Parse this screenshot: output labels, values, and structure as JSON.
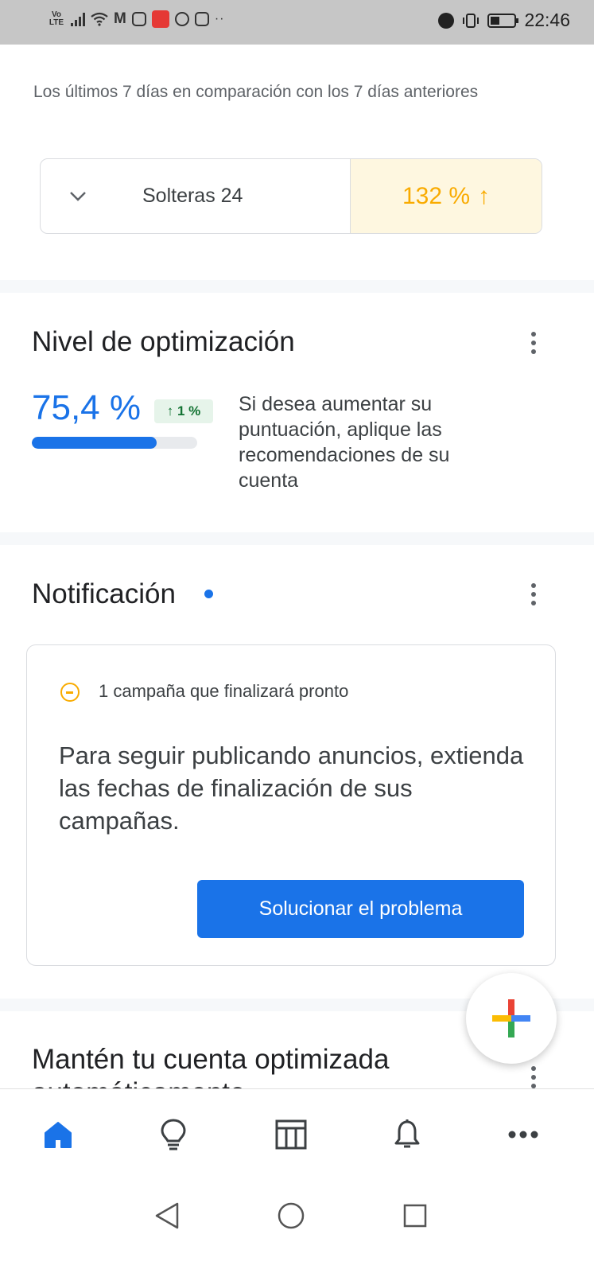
{
  "status_bar": {
    "carrier_label": "Vo LTE",
    "time": "22:46"
  },
  "comparison": {
    "subtitle": "Los últimos 7 días en comparación con los 7 días anteriores",
    "campaign_name": "Solteras 24",
    "change_value": "132 %",
    "change_arrow": "↑",
    "accent_color": "#f9ab00"
  },
  "optimization": {
    "title": "Nivel de optimización",
    "score": "75,4 %",
    "score_fraction": 0.754,
    "delta": "↑ 1 %",
    "description": "Si desea aumentar su puntuación, aplique las recomendaciones de su cuenta"
  },
  "notification": {
    "title": "Notificación",
    "alert_label": "1 campaña que finalizará pronto",
    "body": "Para seguir publicando anuncios, extienda las fechas de finalización de sus campañas.",
    "action_label": "Solucionar el problema"
  },
  "next_section": {
    "title": "Mantén tu cuenta optimizada",
    "title_cont": "automáticamente"
  },
  "bottom_nav": [
    {
      "icon": "home-icon",
      "active": true
    },
    {
      "icon": "lightbulb-icon",
      "active": false
    },
    {
      "icon": "table-icon",
      "active": false
    },
    {
      "icon": "bell-icon",
      "active": false
    },
    {
      "icon": "more-horiz-icon",
      "active": false
    }
  ],
  "colors": {
    "primary": "#1a73e8",
    "warning": "#f9ab00",
    "success": "#137333"
  }
}
